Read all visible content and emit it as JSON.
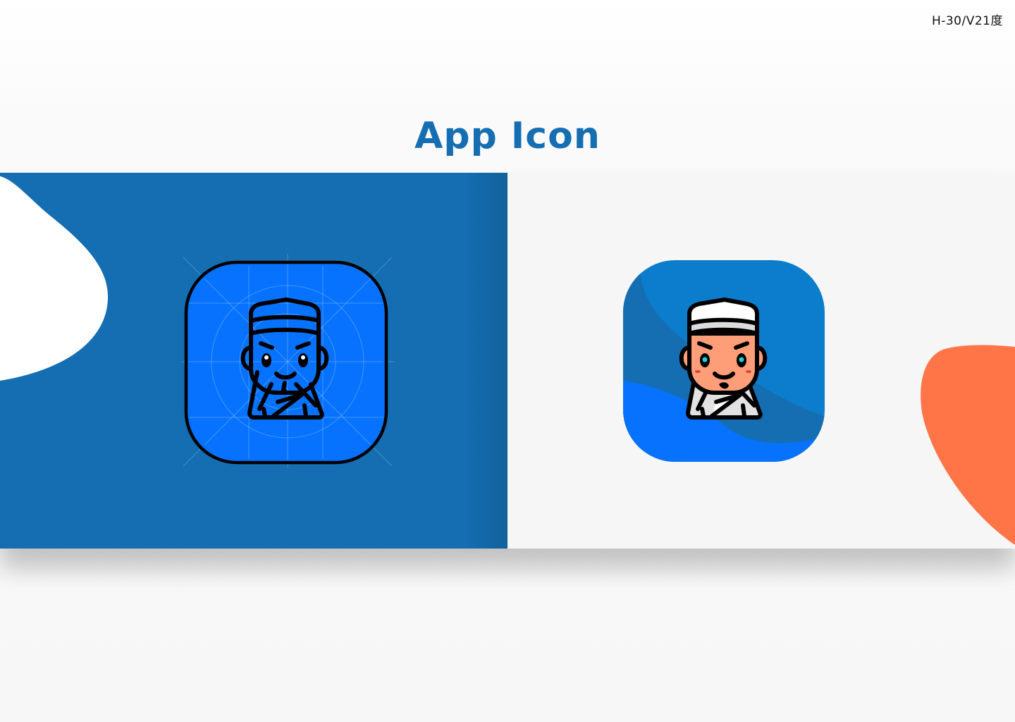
{
  "page": {
    "corner_label": "H-30/V21度",
    "title": "App Icon"
  },
  "colors": {
    "brand_blue": "#156eb1",
    "panel_blue": "#146eb1",
    "icon_blue": "#0672fe",
    "orange_accent": "#ff7548",
    "skin": "#fd9e79",
    "eye_cyan": "#13d6e0",
    "outline": "#000000"
  },
  "panels": {
    "left": {
      "variant": "outline-with-grid"
    },
    "right": {
      "variant": "filled-color"
    }
  },
  "icons": [
    "chef-avatar-outline-icon",
    "chef-avatar-color-icon"
  ]
}
